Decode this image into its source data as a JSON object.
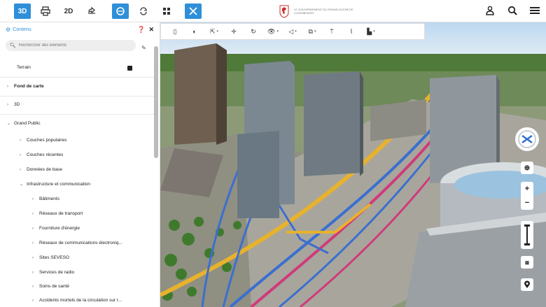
{
  "topbar": {
    "buttons": [
      {
        "label": "3D",
        "active": true
      },
      {
        "label": "",
        "icon": "print-icon"
      },
      {
        "label": "2D",
        "active": false
      },
      {
        "label": "",
        "icon": "share-icon"
      },
      {
        "label": "",
        "icon": "layers-icon",
        "active": true
      },
      {
        "label": "",
        "icon": "sync-icon"
      },
      {
        "label": "",
        "icon": "grid-icon"
      },
      {
        "label": "",
        "icon": "tools-icon",
        "active": true
      }
    ],
    "logo_text": "LE GOUVERNEMENT DU GRAND-DUCHÉ DE LUXEMBOURG",
    "right_icons": [
      "user-icon",
      "search-icon",
      "menu-icon"
    ],
    "accent": "#2f8fd8"
  },
  "panel": {
    "title": "Contenu",
    "search_placeholder": "Rechercher des éléments",
    "items": [
      {
        "label": "Terrain",
        "checked": true
      },
      {
        "label": "Fond de carte"
      },
      {
        "label": "3D"
      },
      {
        "label": "Grand Public"
      },
      {
        "label": "Couches populaires"
      },
      {
        "label": "Couches récentes"
      },
      {
        "label": "Données de base"
      },
      {
        "label": "Infrastructure et communication"
      },
      {
        "label": "Bâtiments"
      },
      {
        "label": "Réseaux de transport"
      },
      {
        "label": "Fourniture d'énergie"
      },
      {
        "label": "Réseaux de communications électroniq..."
      },
      {
        "label": "Sites SEVESO"
      },
      {
        "label": "Services de radio"
      },
      {
        "label": "Soins de santé"
      },
      {
        "label": "Accidents mortels de la circulation sur r..."
      }
    ]
  },
  "map": {
    "toolbar_icons": [
      "sidebar-toggle-icon",
      "globe-icon",
      "pointer-icon",
      "crosshair-icon",
      "rotate-icon",
      "view-icon",
      "measure-icon",
      "camera-icon",
      "pin-icon",
      "profile-icon",
      "chart-icon"
    ],
    "controls": [
      "compass-icon",
      "locate-icon",
      "zoom-in-icon",
      "zoom-out-icon",
      "pegman-icon",
      "layers-icon",
      "location-icon"
    ],
    "zoom_in": "+",
    "zoom_out": "−"
  }
}
